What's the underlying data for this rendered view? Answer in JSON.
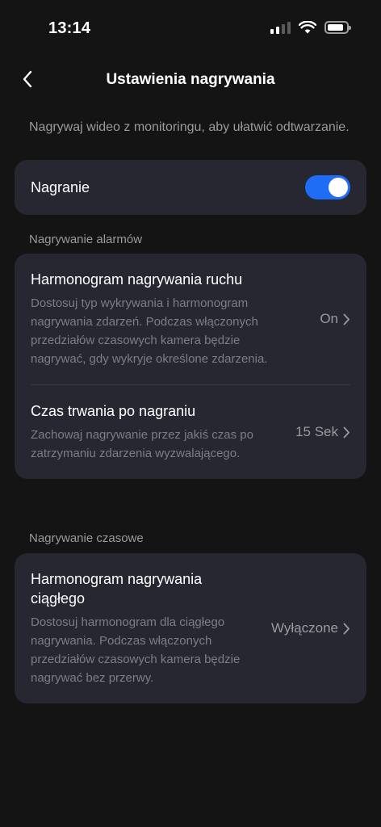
{
  "status_bar": {
    "time": "13:14",
    "icons": [
      "cellular-signal-icon",
      "wifi-icon",
      "battery-icon"
    ]
  },
  "header": {
    "back_icon": "chevron-left-icon",
    "title": "Ustawienia nagrywania"
  },
  "intro": "Nagrywaj wideo z monitoringu, aby ułatwić odtwarzanie.",
  "recording_toggle": {
    "label": "Nagranie",
    "state": "on"
  },
  "alarm_section": {
    "label": "Nagrywanie alarmów",
    "items": [
      {
        "title": "Harmonogram nagrywania ruchu",
        "description": "Dostosuj typ wykrywania i harmonogram nagrywania zdarzeń. Podczas włączonych przedziałów czasowych kamera będzie nagrywać, gdy wykryje określone zdarzenia.",
        "value": "On"
      },
      {
        "title": "Czas trwania po nagraniu",
        "description": "Zachowaj nagrywanie przez jakiś czas po zatrzymaniu zdarzenia wyzwalającego.",
        "value": "15 Sek"
      }
    ]
  },
  "timed_section": {
    "label": "Nagrywanie czasowe",
    "items": [
      {
        "title": "Harmonogram nagrywania ciągłego",
        "description": "Dostosuj harmonogram dla ciągłego nagrywania. Podczas włączonych przedziałów czasowych kamera będzie nagrywać bez przerwy.",
        "value": "Wyłączone"
      }
    ]
  },
  "colors": {
    "background": "#141414",
    "card": "#262730",
    "accent": "#1f6cf5",
    "secondary_text": "#9a9a9f"
  }
}
